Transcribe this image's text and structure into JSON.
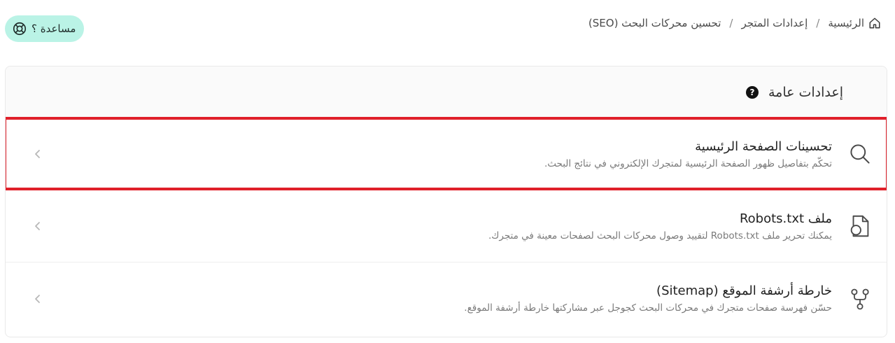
{
  "breadcrumb": {
    "home": "الرئيسية",
    "store_settings": "إعدادات المتجر",
    "current": "تحسين محركات البحث (SEO)",
    "separator": "/"
  },
  "help_button": {
    "label": "مساعدة ؟",
    "background": "#baf3e6"
  },
  "card": {
    "title": "إعدادات عامة",
    "rows": [
      {
        "title": "تحسينات الصفحة الرئيسية",
        "description": "تحكّم بتفاصيل ظهور الصفحة الرئيسية لمتجرك الإلكتروني في نتائج البحث.",
        "icon": "search-icon",
        "highlighted": true
      },
      {
        "title": "ملف Robots.txt",
        "description": "يمكنك تحرير ملف Robots.txt لتقييد وصول محركات البحث لصفحات معينة في متجرك.",
        "icon": "robot-file-icon",
        "highlighted": false
      },
      {
        "title": "خارطة أرشفة الموقع (Sitemap)",
        "description": "حسّن فهرسة صفحات متجرك في محركات البحث كجوجل عبر مشاركتها خارطة أرشفة الموقع.",
        "icon": "sitemap-icon",
        "highlighted": false
      }
    ]
  },
  "colors": {
    "highlight": "#e0202a",
    "accent": "#baf3e6"
  }
}
